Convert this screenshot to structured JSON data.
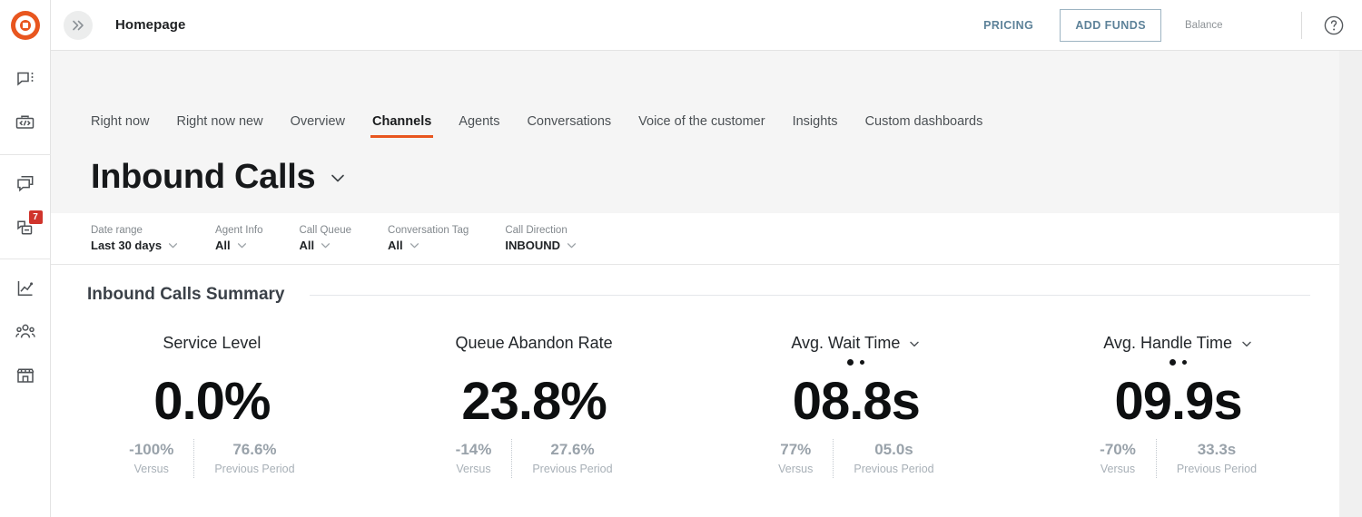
{
  "topbar": {
    "expand_icon": "chevron-double-right-icon",
    "page_title": "Homepage",
    "pricing_label": "PRICING",
    "add_funds_label": "ADD FUNDS",
    "balance_label": "Balance",
    "balance_value": "",
    "help_icon": "help-circle-icon"
  },
  "sidebar": {
    "logo_icon": "target-logo-icon",
    "groups": [
      {
        "items": [
          {
            "icon": "chat-bubble-menu-icon",
            "badge": ""
          },
          {
            "icon": "code-briefcase-icon",
            "badge": ""
          }
        ]
      },
      {
        "items": [
          {
            "icon": "stacked-chats-icon",
            "badge": ""
          },
          {
            "icon": "documents-icon",
            "badge": "7"
          }
        ]
      },
      {
        "items": [
          {
            "icon": "analytics-chart-icon",
            "badge": ""
          },
          {
            "icon": "people-group-icon",
            "badge": ""
          },
          {
            "icon": "storefront-icon",
            "badge": ""
          }
        ]
      }
    ]
  },
  "tabs": [
    {
      "label": "Right now",
      "active": false
    },
    {
      "label": "Right now new",
      "active": false
    },
    {
      "label": "Overview",
      "active": false
    },
    {
      "label": "Channels",
      "active": true
    },
    {
      "label": "Agents",
      "active": false
    },
    {
      "label": "Conversations",
      "active": false
    },
    {
      "label": "Voice of the customer",
      "active": false
    },
    {
      "label": "Insights",
      "active": false
    },
    {
      "label": "Custom dashboards",
      "active": false
    }
  ],
  "page": {
    "heading": "Inbound Calls",
    "heading_caret_icon": "chevron-down-icon"
  },
  "filters": [
    {
      "label": "Date range",
      "value": "Last 30 days"
    },
    {
      "label": "Agent Info",
      "value": "All"
    },
    {
      "label": "Call Queue",
      "value": "All"
    },
    {
      "label": "Conversation Tag",
      "value": "All"
    },
    {
      "label": "Call Direction",
      "value": "INBOUND"
    }
  ],
  "summary": {
    "title": "Inbound Calls Summary",
    "versus_label": "Versus",
    "previous_label": "Previous Period",
    "cards": [
      {
        "title": "Service Level",
        "value": "0.0%",
        "has_caret": false,
        "has_dots": false,
        "versus_value": "-100%",
        "versus_label": "Versus",
        "previous_value": "76.6%",
        "previous_label": "Previous Period"
      },
      {
        "title": "Queue Abandon Rate",
        "value": "23.8%",
        "has_caret": false,
        "has_dots": false,
        "versus_value": "-14%",
        "versus_label": "Versus",
        "previous_value": "27.6%",
        "previous_label": "Previous Period"
      },
      {
        "title": "Avg. Wait Time",
        "value": "08.8s",
        "has_caret": true,
        "has_dots": true,
        "versus_value": "77%",
        "versus_label": "Versus",
        "previous_value": "05.0s",
        "previous_label": "Previous Period"
      },
      {
        "title": "Avg. Handle Time",
        "value": "09.9s",
        "has_caret": true,
        "has_dots": true,
        "versus_value": "-70%",
        "versus_label": "Versus",
        "previous_value": "33.3s",
        "previous_label": "Previous Period"
      }
    ]
  },
  "colors": {
    "accent": "#e8561f",
    "badge": "#d0342c",
    "link": "#5d8299",
    "band": "#f5f5f5"
  }
}
